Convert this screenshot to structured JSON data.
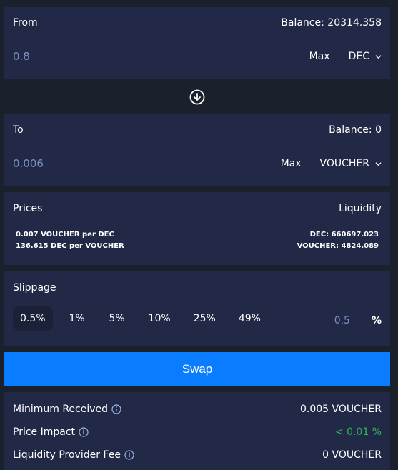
{
  "from": {
    "label": "From",
    "balance": "Balance: 20314.358",
    "amount": "0.8",
    "max_label": "Max",
    "token": "DEC"
  },
  "swap_direction_icon": "arrow-down-circle-icon",
  "to": {
    "label": "To",
    "balance": "Balance: 0",
    "amount": "0.006",
    "max_label": "Max",
    "token": "VOUCHER"
  },
  "prices": {
    "label": "Prices",
    "lines": [
      "0.007 VOUCHER per DEC",
      "136.615 DEC per VOUCHER"
    ]
  },
  "liquidity": {
    "label": "Liquidity",
    "lines": [
      "DEC: 660697.023",
      "VOUCHER: 4824.089"
    ]
  },
  "slippage": {
    "label": "Slippage",
    "options": [
      "0.5%",
      "1%",
      "5%",
      "10%",
      "25%",
      "49%"
    ],
    "selected": "0.5%",
    "custom_value": "0.5",
    "unit": "%"
  },
  "swap_button": "Swap",
  "details": {
    "minimum_received": {
      "label": "Minimum Received",
      "value": "0.005 VOUCHER"
    },
    "price_impact": {
      "label": "Price Impact",
      "value": "< 0.01 %"
    },
    "lp_fee": {
      "label": "Liquidity Provider Fee",
      "value": "0 VOUCHER"
    }
  },
  "colors": {
    "background": "#1b202d",
    "card": "#212947",
    "accent": "#0a7cff",
    "muted_value": "#7d8fc0",
    "positive": "#2fb35a"
  }
}
